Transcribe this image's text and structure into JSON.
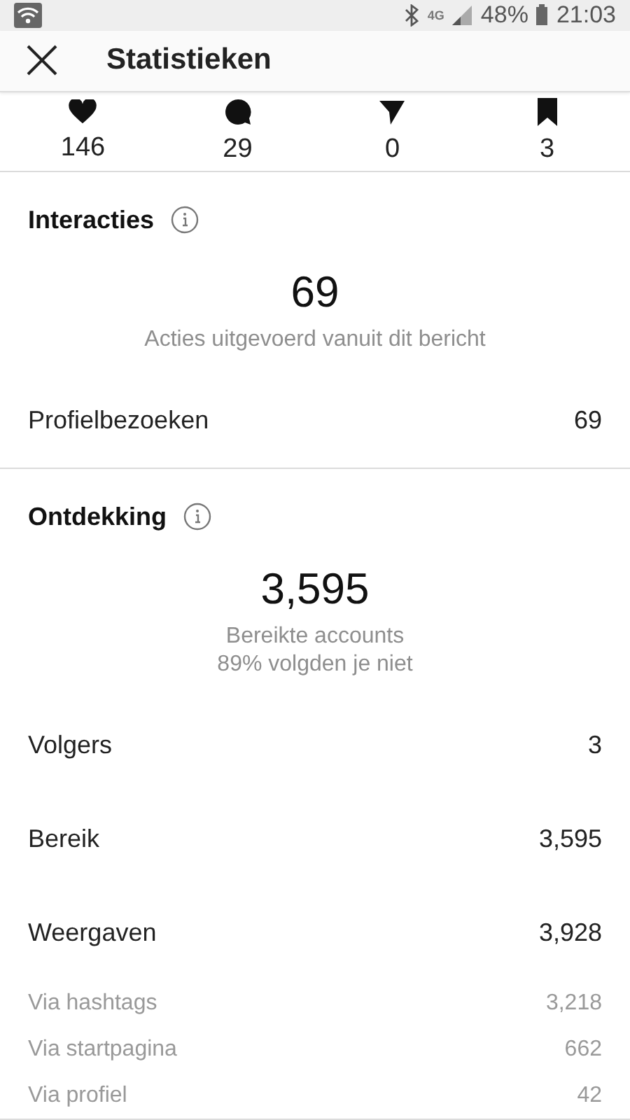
{
  "status_bar": {
    "network": "4G",
    "battery": "48%",
    "time": "21:03"
  },
  "header": {
    "title": "Statistieken"
  },
  "counts": [
    {
      "kind": "heart",
      "value": "146"
    },
    {
      "kind": "comment",
      "value": "29"
    },
    {
      "kind": "send",
      "value": "0"
    },
    {
      "kind": "bookmark",
      "value": "3"
    }
  ],
  "sections": [
    {
      "title": "Interacties",
      "big_value": "69",
      "captions": [
        "Acties uitgevoerd vanuit dit bericht"
      ],
      "rows": [
        {
          "kind": "main",
          "label": "Profielbezoeken",
          "value": "69"
        }
      ]
    },
    {
      "title": "Ontdekking",
      "big_value": "3,595",
      "captions": [
        "Bereikte accounts",
        "89% volgden je niet"
      ],
      "rows": [
        {
          "kind": "main",
          "label": "Volgers",
          "value": "3"
        },
        {
          "kind": "main",
          "label": "Bereik",
          "value": "3,595"
        },
        {
          "kind": "main",
          "label": "Weergaven",
          "value": "3,928"
        },
        {
          "kind": "sub",
          "label": "Via hashtags",
          "value": "3,218"
        },
        {
          "kind": "sub",
          "label": "Via startpagina",
          "value": "662"
        },
        {
          "kind": "sub",
          "label": "Via profiel",
          "value": "42"
        }
      ]
    }
  ]
}
